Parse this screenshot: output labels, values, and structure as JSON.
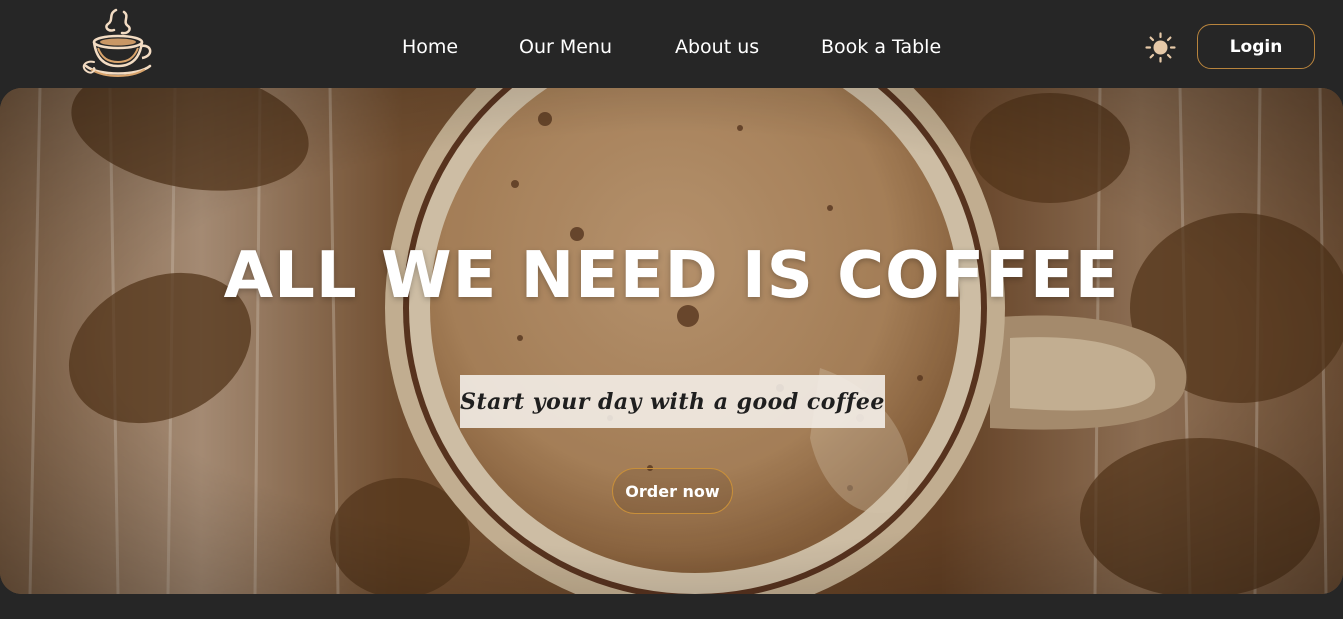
{
  "header": {
    "logo_icon": "coffee-cup-logo",
    "nav": {
      "home": "Home",
      "menu": "Our Menu",
      "about": "About us",
      "book": "Book a Table"
    },
    "theme_icon": "sun-icon",
    "login_label": "Login"
  },
  "hero": {
    "title": "ALL WE NEED IS COFFEE",
    "subtitle": "Start your day with a good coffee",
    "order_label": "Order now",
    "background": "coffee-cup-photo"
  },
  "colors": {
    "background": "#262626",
    "accent": "#c88f3a",
    "text": "#ffffff"
  }
}
